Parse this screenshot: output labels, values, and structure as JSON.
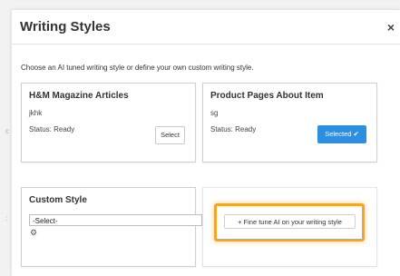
{
  "modal": {
    "title": "Writing Styles",
    "close_glyph": "×",
    "intro": "Choose an AI tuned writing style or define your own custom writing style."
  },
  "cards": [
    {
      "title": "H&M Magazine Articles",
      "subtitle": "jkhk",
      "status": "Status: Ready",
      "button_label": "Select"
    },
    {
      "title": "Product Pages About Item",
      "subtitle": "sg",
      "status": "Status: Ready",
      "button_label": "Selected ✔"
    }
  ],
  "custom_style": {
    "title": "Custom Style",
    "select_value": "-Select-",
    "gear_icon": "gear-icon"
  },
  "fine_tune": {
    "label": "+ Fine tune AI on your writing style"
  },
  "colors": {
    "accent_blue": "#2e8fe0",
    "highlight_orange": "#f2a52a"
  }
}
